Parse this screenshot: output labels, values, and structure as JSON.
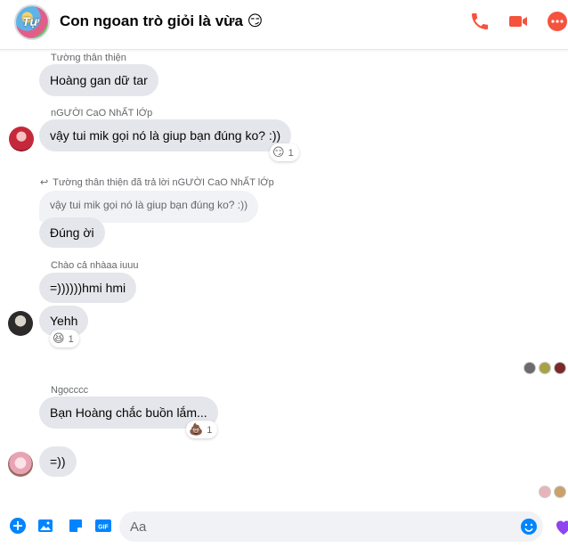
{
  "header": {
    "group_avatar_text": "Tự",
    "title": "Con ngoan trò giỏi là vừa 😏",
    "accent_color": "#f5533d"
  },
  "messages": {
    "m1": {
      "sender": "Tường thân thiện",
      "text": "Hoàng gan dữ tar"
    },
    "m2": {
      "sender": "nGƯỜI CaO NhẤT lỚp",
      "text": "vậy tui mik gọi nó là giup bạn đúng ko? :))",
      "reaction_emoji": "😏",
      "reaction_count": "1"
    },
    "m3": {
      "reply_note": "Tường thân thiện đã trả lời nGƯỜI CaO NhẤT lỚp",
      "quoted": "vậy tui mik gọi nó là giup bạn đúng ko? :))",
      "text": "Đúng ời"
    },
    "m4": {
      "sender": "Chào cả nhàaa iuuu",
      "text": "=))))))hmi hmi"
    },
    "m5": {
      "text": "Yehh",
      "reaction_emoji": "😆",
      "reaction_count": "1"
    },
    "m6": {
      "sender": "Ngọcccc",
      "text": "Bạn Hoàng chắc buồn lắm...",
      "reaction_emoji": "💩",
      "reaction_count": "1"
    },
    "m7": {
      "text": "=))"
    }
  },
  "composer": {
    "placeholder": "Aa",
    "icons": [
      "plus-icon",
      "photo-icon",
      "sticker-icon",
      "gif-icon",
      "emoji-icon",
      "heart-icon"
    ],
    "gif_label": "GIF",
    "accent_color": "#0084ff"
  }
}
